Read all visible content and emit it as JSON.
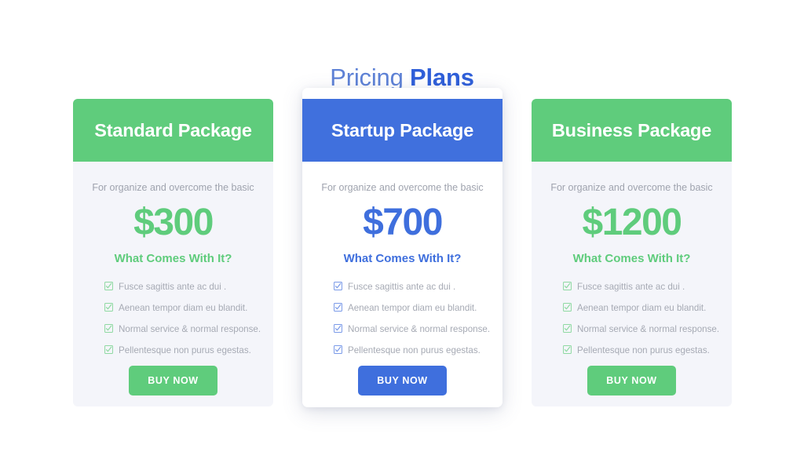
{
  "header": {
    "title_light": "Pricing",
    "title_strong": "Plans"
  },
  "colors": {
    "green": "#5FCC7C",
    "blue": "#4070DD",
    "title_blue": "#2F5FD9",
    "card_bg": "#F4F5FA",
    "featured_card_bg": "#FFFFFF",
    "muted_text": "#A6AAB4",
    "page_bg": "#FFFFFF"
  },
  "plans": [
    {
      "name": "Standard Package",
      "subtitle": "For organize and overcome the basic",
      "price": "$300",
      "features_title": "What Comes With It?",
      "features": [
        "Fusce sagittis ante ac dui .",
        "Aenean tempor diam eu blandit.",
        "Normal service & normal response.",
        "Pellentesque non purus egestas."
      ],
      "cta_label": "BUY NOW",
      "accent": "#5FCC7C",
      "featured": false
    },
    {
      "name": "Startup Package",
      "subtitle": "For organize and overcome the basic",
      "price": "$700",
      "features_title": "What Comes With It?",
      "features": [
        "Fusce sagittis ante ac dui .",
        "Aenean tempor diam eu blandit.",
        "Normal service & normal response.",
        "Pellentesque non purus egestas."
      ],
      "cta_label": "BUY NOW",
      "accent": "#4070DD",
      "featured": true
    },
    {
      "name": "Business Package",
      "subtitle": "For organize and overcome the basic",
      "price": "$1200",
      "features_title": "What Comes With It?",
      "features": [
        "Fusce sagittis ante ac dui .",
        "Aenean tempor diam eu blandit.",
        "Normal service & normal response.",
        "Pellentesque non purus egestas."
      ],
      "cta_label": "BUY NOW",
      "accent": "#5FCC7C",
      "featured": false
    }
  ],
  "icons": {
    "feature_check": "checkbox-check-icon"
  }
}
